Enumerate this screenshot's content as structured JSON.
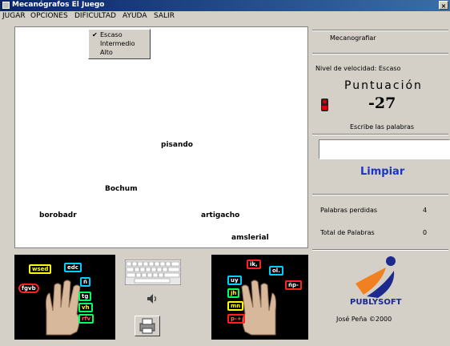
{
  "window": {
    "title": "Mecanógrafos El Juego",
    "close_glyph": "×"
  },
  "menu": {
    "items": [
      "JUGAR",
      "OPCIONES",
      "DIFICULTAD",
      "AYUDA",
      "SALIR"
    ]
  },
  "difficulty_menu": {
    "options": [
      "Escaso",
      "Intermedio",
      "Alto"
    ],
    "checked_index": 0,
    "check_glyph": "✔"
  },
  "game": {
    "words": [
      "pisando",
      "Bochum",
      "borobadr",
      "artigacho",
      "amslerial"
    ]
  },
  "sidebar": {
    "mode_text": "Mecanografiar",
    "level_text": "Nivel de velocidad: Escaso",
    "score_label": "Puntuación",
    "score_value": "-27",
    "typed_label": "Escribe las palabras",
    "input_value": "",
    "clear_label": "Limpiar",
    "lost_words_label": "Palabras perdidas",
    "lost_words_value": "4",
    "total_words_label": "Total de Palabras",
    "total_words_value": "0"
  },
  "left_panel": {
    "tags": [
      "wsed",
      "edc",
      "fgvb",
      "ñ",
      "tg",
      "vh",
      "rfv"
    ]
  },
  "right_panel": {
    "tags": [
      "ik,",
      "ol.",
      "ñp-",
      "uy",
      "jh",
      "mn",
      "p-+"
    ]
  },
  "brand": {
    "name": "PUBLYSOFT",
    "author": "José Peña ©2000"
  },
  "colors": {
    "clear_button": "#1b33c8",
    "brand_blue": "#1b2a8c",
    "brand_orange": "#f08020",
    "title_bar": "#0a246a"
  },
  "icons": [
    "keyboard-icon",
    "speaker-icon",
    "print-icon",
    "traffic-light-icon"
  ]
}
